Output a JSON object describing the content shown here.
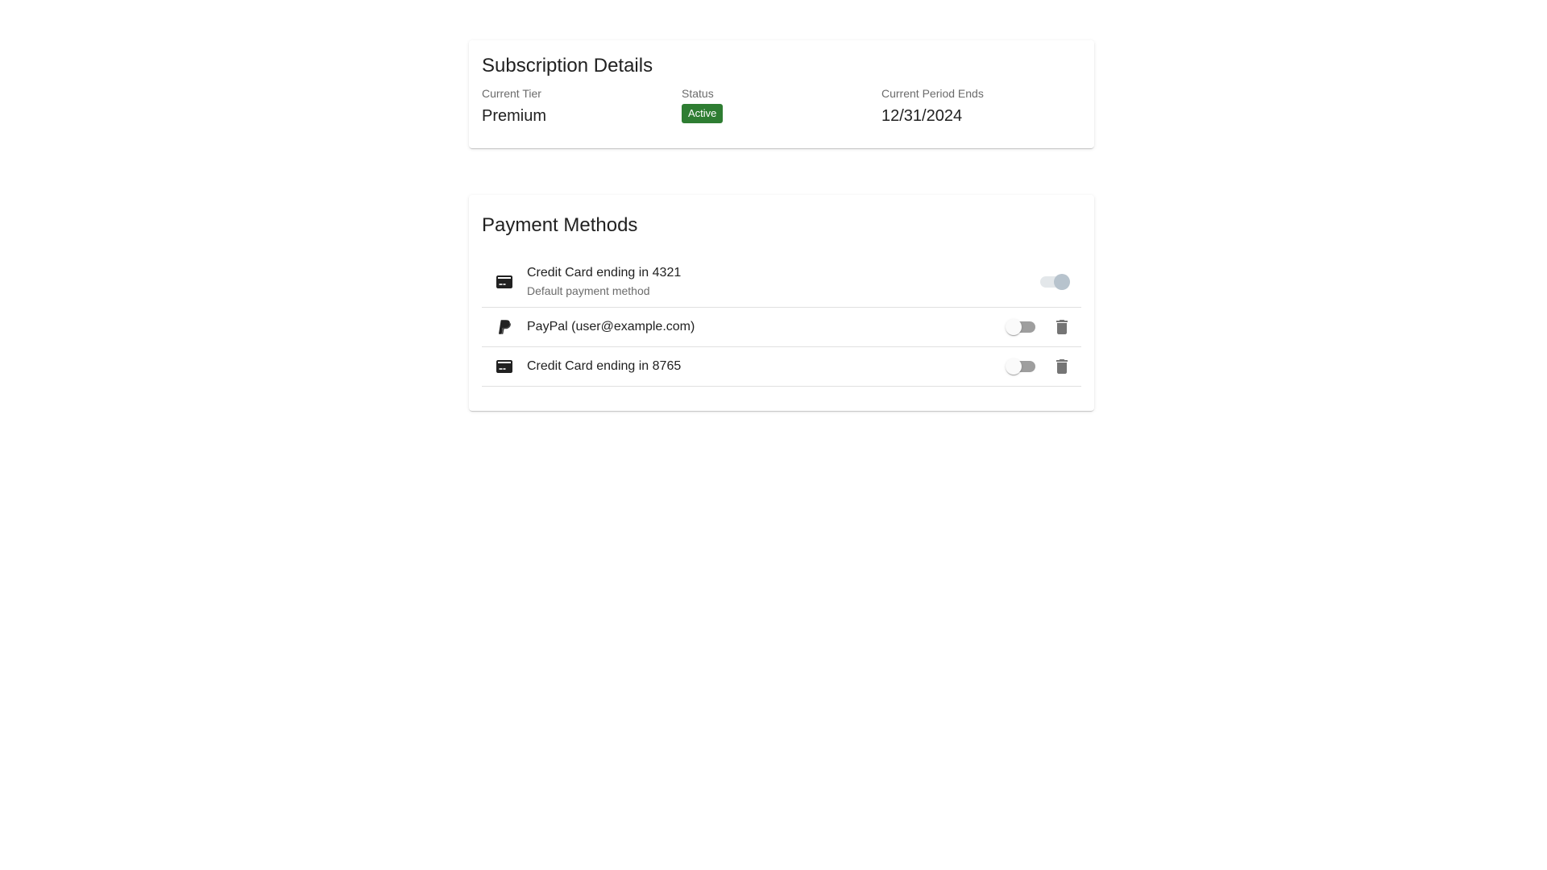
{
  "subscription": {
    "title": "Subscription Details",
    "tier_label": "Current Tier",
    "tier_value": "Premium",
    "status_label": "Status",
    "status_value": "Active",
    "status_color": "#2e7d32",
    "period_label": "Current Period Ends",
    "period_value": "12/31/2024"
  },
  "payment": {
    "title": "Payment Methods",
    "items": [
      {
        "name": "Credit Card ending in 4321",
        "subtitle": "Default payment method",
        "icon": "credit-card-icon",
        "default_toggle_on": true
      },
      {
        "name": "PayPal (user@example.com)",
        "icon": "paypal-icon",
        "default_toggle_on": false,
        "delete_icon": "trash-icon"
      },
      {
        "name": "Credit Card ending in 8765",
        "icon": "credit-card-icon",
        "default_toggle_on": false,
        "delete_icon": "trash-icon"
      }
    ]
  }
}
